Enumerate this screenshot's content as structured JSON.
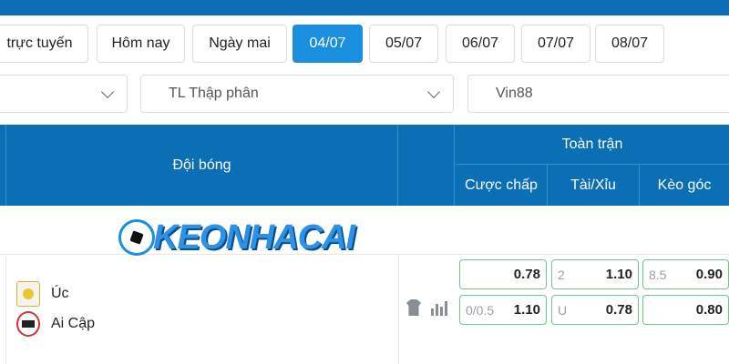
{
  "date_tabs": [
    {
      "label": "trực tuyến",
      "active": false
    },
    {
      "label": "Hôm nay",
      "active": false
    },
    {
      "label": "Ngày mai",
      "active": false
    },
    {
      "label": "04/07",
      "active": true
    },
    {
      "label": "05/07",
      "active": false
    },
    {
      "label": "06/07",
      "active": false
    },
    {
      "label": "07/07",
      "active": false
    },
    {
      "label": "08/07",
      "active": false
    }
  ],
  "filters": {
    "odds_format": "TL Thập phân",
    "bookmaker": "Vin88"
  },
  "table_header": {
    "team": "Đội bóng",
    "full_match": "Toàn trận",
    "handicap": "Cược chấp",
    "over_under": "Tài/Xỉu",
    "corners": "Kèo góc"
  },
  "watermark": "KEONHACAI",
  "match": {
    "home": "Úc",
    "away": "Ai Cập",
    "odds": {
      "handicap": [
        {
          "line": "",
          "value": "0.78"
        },
        {
          "line": "0/0.5",
          "value": "1.10"
        }
      ],
      "over_under": [
        {
          "line": "2",
          "value": "1.10"
        },
        {
          "line": "U",
          "value": "0.78"
        }
      ],
      "corners": [
        {
          "line": "8.5",
          "value": "0.90"
        },
        {
          "line": "",
          "value": "0.80"
        }
      ]
    }
  },
  "colors": {
    "header_blue": "#0a6fb5",
    "active_tab": "#1a8fe0",
    "odds_border": "#6ec48b"
  }
}
